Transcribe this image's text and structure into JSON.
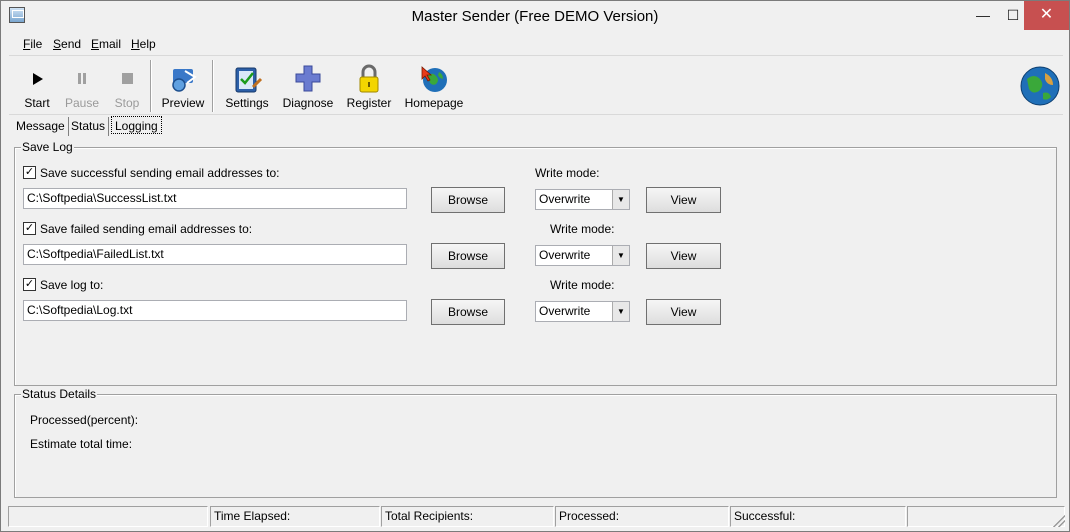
{
  "window": {
    "title": "Master Sender (Free DEMO Version)",
    "controls": {
      "minimize": "—",
      "maximize": "☐",
      "close": "✕"
    }
  },
  "menu": [
    {
      "label": "File",
      "accel": "F",
      "rest": "ile"
    },
    {
      "label": "Send",
      "accel": "S",
      "rest": "end"
    },
    {
      "label": "Email",
      "accel": "E",
      "rest": "mail"
    },
    {
      "label": "Help",
      "accel": "H",
      "rest": "elp"
    }
  ],
  "toolbar": {
    "start": {
      "label": "Start",
      "icon": "play-icon",
      "enabled": true
    },
    "pause": {
      "label": "Pause",
      "icon": "pause-icon",
      "enabled": false
    },
    "stop": {
      "label": "Stop",
      "icon": "stop-icon",
      "enabled": false
    },
    "preview": {
      "label": "Preview",
      "icon": "preview-icon"
    },
    "settings": {
      "label": "Settings",
      "icon": "settings-icon"
    },
    "diagnose": {
      "label": "Diagnose",
      "icon": "diagnose-icon"
    },
    "register": {
      "label": "Register",
      "icon": "padlock-icon"
    },
    "homepage": {
      "label": "Homepage",
      "icon": "globe-cursor-icon"
    }
  },
  "tabs": {
    "message": "Message",
    "status": "Status",
    "logging": "Logging",
    "active": "Logging"
  },
  "save_log": {
    "title": "Save Log",
    "rows": [
      {
        "checked": true,
        "label": "Save successful  sending email addresses to:",
        "path": "C:\\Softpedia\\SuccessList.txt",
        "browse": "Browse",
        "write_mode_label": "Write mode:",
        "write_mode": "Overwrite",
        "view": "View"
      },
      {
        "checked": true,
        "label": "Save failed  sending email addresses to:",
        "path": "C:\\Softpedia\\FailedList.txt",
        "browse": "Browse",
        "write_mode_label": "Write mode:",
        "write_mode": "Overwrite",
        "view": "View"
      },
      {
        "checked": true,
        "label": "Save log to:",
        "path": "C:\\Softpedia\\Log.txt",
        "browse": "Browse",
        "write_mode_label": "Write mode:",
        "write_mode": "Overwrite",
        "view": "View"
      }
    ]
  },
  "status_details": {
    "title": "Status Details",
    "processed_percent": "Processed(percent):",
    "estimate_total_time": "Estimate total time:"
  },
  "statusbar": {
    "time_elapsed": "Time Elapsed:",
    "total_recipients": "Total Recipients:",
    "processed": "Processed:",
    "successful": "Successful:"
  },
  "colors": {
    "window_bg": "#f0f0f0",
    "close_button": "#c75050",
    "globe_blue": "#1f6fb8"
  }
}
